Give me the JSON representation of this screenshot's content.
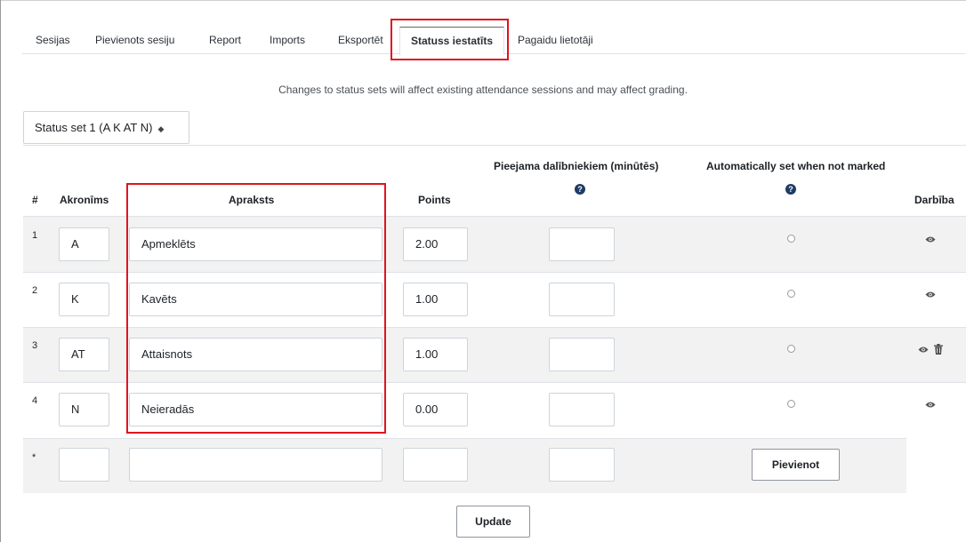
{
  "tabs": [
    {
      "label": "Sesijas"
    },
    {
      "label": "Pievienots sesiju"
    },
    {
      "label": "Report"
    },
    {
      "label": "Imports"
    },
    {
      "label": "Eksportēt"
    },
    {
      "label": "Statuss iestatīts"
    },
    {
      "label": "Pagaidu lietotāji"
    }
  ],
  "notice": "Changes to status sets will affect existing attendance sessions and may affect grading.",
  "status_set": {
    "selected": "Status set 1 (A K AT N)"
  },
  "table": {
    "headers": {
      "num": "#",
      "acronym": "Akronīms",
      "description": "Apraksts",
      "points": "Points",
      "students_minutes": "Pieejama dalībniekiem (minūtēs)",
      "auto_set": "Automatically set when not marked",
      "action": "Darbība"
    },
    "rows": [
      {
        "num": "1",
        "acronym": "A",
        "description": "Apmeklēts",
        "points": "2.00",
        "minutes": "",
        "deletable": false
      },
      {
        "num": "2",
        "acronym": "K",
        "description": "Kavēts",
        "points": "1.00",
        "minutes": "",
        "deletable": false
      },
      {
        "num": "3",
        "acronym": "AT",
        "description": "Attaisnots",
        "points": "1.00",
        "minutes": "",
        "deletable": true
      },
      {
        "num": "4",
        "acronym": "N",
        "description": "Neieradās",
        "points": "0.00",
        "minutes": "",
        "deletable": false
      }
    ],
    "new_row": {
      "num": "*",
      "acronym": "",
      "description": "",
      "points": "",
      "minutes": "",
      "add_label": "Pievienot"
    }
  },
  "update_label": "Update",
  "colors": {
    "highlight": "#e0141e",
    "help_icon": "#1f3b66",
    "stripe": "#f2f2f2"
  }
}
